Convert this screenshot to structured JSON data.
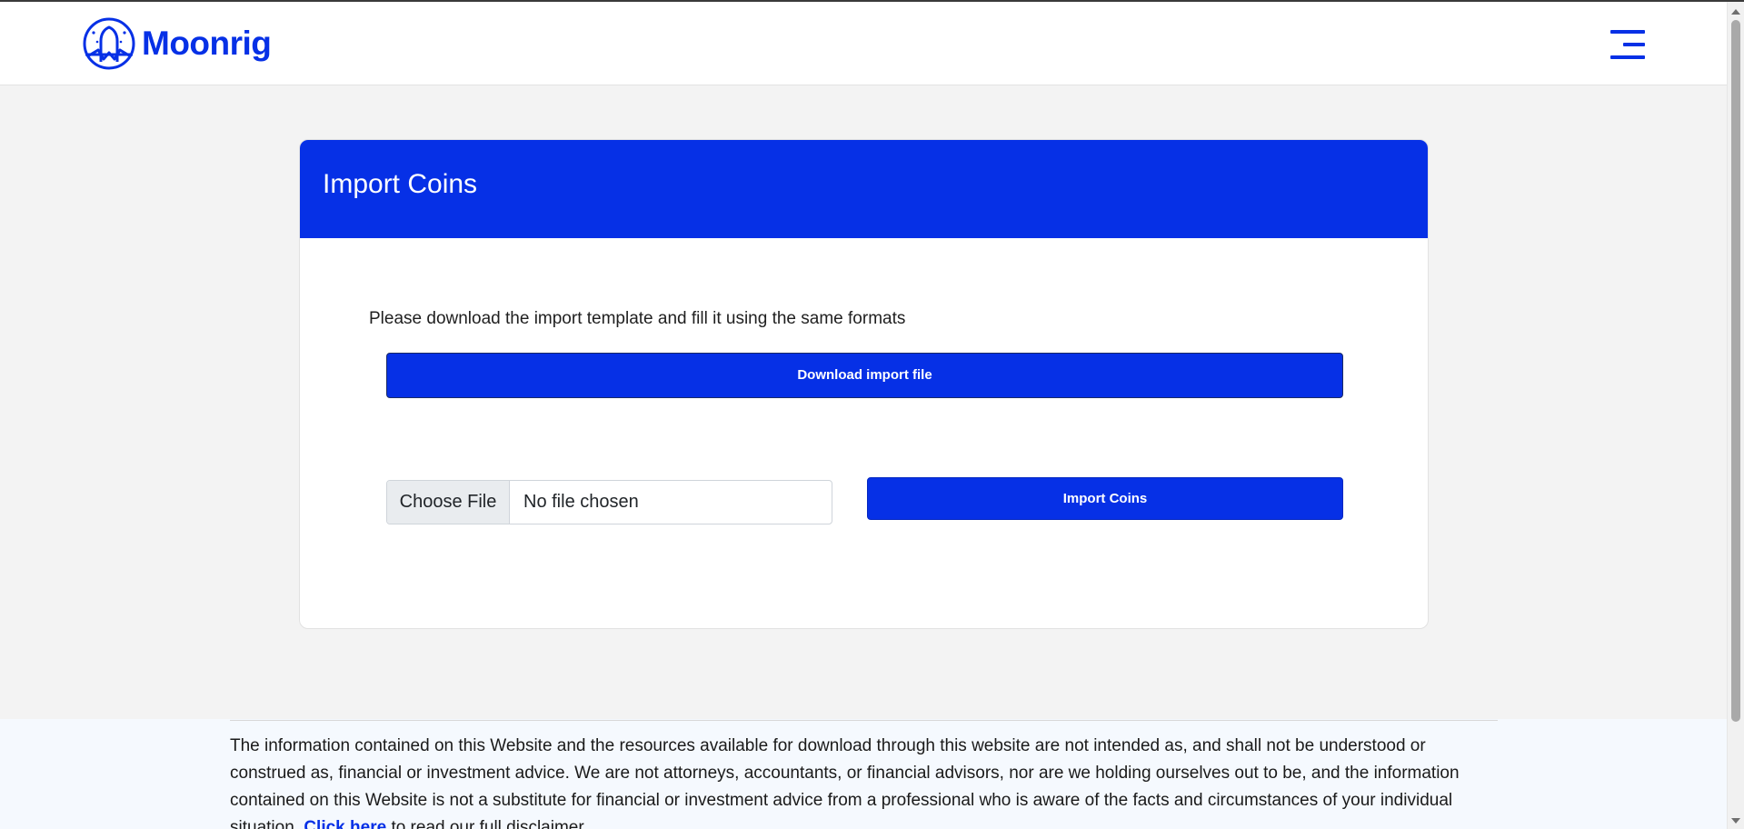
{
  "header": {
    "logo_text": "Moonrig",
    "brand_color": "#0630e6",
    "logo_icon": "moon-shield-icon",
    "menu_icon": "hamburger-menu-icon"
  },
  "card": {
    "title": "Import Coins",
    "instruction": "Please download the import template and fill it using the same formats",
    "download_label": "Download import file",
    "file_input": {
      "button_label": "Choose File",
      "status": "No file chosen"
    },
    "import_label": "Import Coins"
  },
  "footer": {
    "disclaimer_text": "The information contained on this Website and the resources available for download through this website are not intended as, and shall not be understood or construed as, financial or investment advice. We are not attorneys, accountants, or financial advisors, nor are we holding ourselves out to be, and the information contained on this Website is not a substitute for financial or investment advice from a professional who is aware of the facts and circumstances of your individual situation.",
    "link_label": "Click here",
    "after_link_text": "to read our full disclaimer."
  }
}
